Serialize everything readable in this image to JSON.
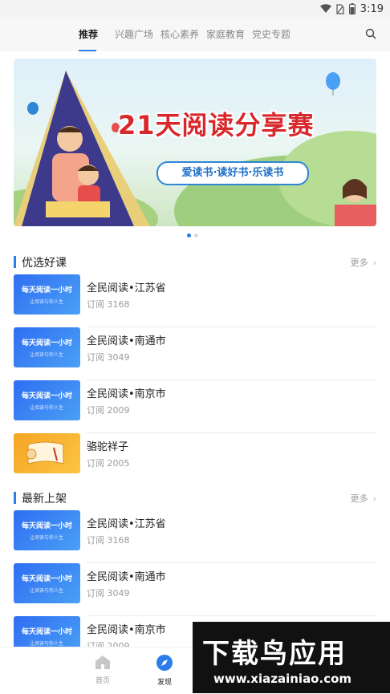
{
  "status_bar": {
    "time": "3:19"
  },
  "top_tabs": [
    {
      "label": "推荐",
      "active": true
    },
    {
      "label": "兴趣广场",
      "active": false
    },
    {
      "label": "核心素养",
      "active": false
    },
    {
      "label": "家庭教育",
      "active": false
    },
    {
      "label": "党史专题",
      "active": false
    }
  ],
  "banner": {
    "title": "21天阅读分享赛",
    "slogan": "爱读书·读好书·乐读书"
  },
  "sections": [
    {
      "title": "优选好课",
      "more": "更多",
      "items": [
        {
          "name": "全民阅读•江苏省",
          "subs": "订阅 3168",
          "thumb_title": "每天阅读一小时",
          "thumb_sub": "让阅读与你人生"
        },
        {
          "name": "全民阅读•南通市",
          "subs": "订阅 3049",
          "thumb_title": "每天阅读一小时",
          "thumb_sub": "让阅读与你人生"
        },
        {
          "name": "全民阅读•南京市",
          "subs": "订阅 2009",
          "thumb_title": "每天阅读一小时",
          "thumb_sub": "让阅读与你人生"
        },
        {
          "name": "骆驼祥子",
          "subs": "订阅 2005",
          "thumb_title": "",
          "thumb_sub": ""
        }
      ]
    },
    {
      "title": "最新上架",
      "more": "更多",
      "items": [
        {
          "name": "全民阅读•江苏省",
          "subs": "订阅 3168",
          "thumb_title": "每天阅读一小时",
          "thumb_sub": "让阅读与你人生"
        },
        {
          "name": "全民阅读•南通市",
          "subs": "订阅 3049",
          "thumb_title": "每天阅读一小时",
          "thumb_sub": "让阅读与你人生"
        },
        {
          "name": "全民阅读•南京市",
          "subs": "订阅 2009",
          "thumb_title": "每天阅读一小时",
          "thumb_sub": "让阅读与你人生"
        }
      ]
    }
  ],
  "bottom_nav": [
    {
      "label": "首页",
      "icon": "home-icon",
      "active": false
    },
    {
      "label": "发现",
      "icon": "compass-icon",
      "active": true
    }
  ],
  "watermark": {
    "title": "下载鸟应用",
    "url": "www.xiazainiao.com"
  },
  "colors": {
    "accent": "#2b7de9",
    "banner_title": "#d8282c"
  }
}
